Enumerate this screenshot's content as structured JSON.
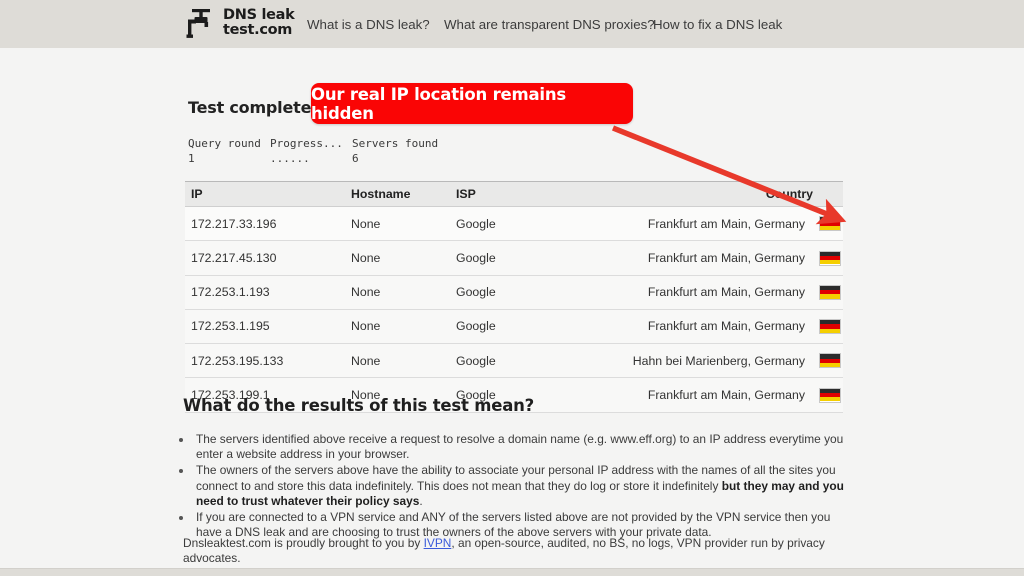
{
  "header": {
    "brand": {
      "line1": "DNS leak",
      "line2": "test.com",
      "icon": "faucet-icon"
    },
    "nav": [
      {
        "label": "What is a DNS leak?"
      },
      {
        "label": "What are transparent DNS proxies?"
      },
      {
        "label": "How to fix a DNS leak"
      }
    ]
  },
  "result": {
    "heading": "Test complete",
    "annotation_badge": "Our real IP location remains hidden",
    "badge_color": "#fa0505",
    "status": [
      {
        "label": "Query round",
        "value": "1"
      },
      {
        "label": "Progress...",
        "value": "......"
      },
      {
        "label": "Servers found",
        "value": "6"
      }
    ]
  },
  "table": {
    "columns": [
      "IP",
      "Hostname",
      "ISP",
      "Country"
    ],
    "rows": [
      {
        "ip": "172.217.33.196",
        "hostname": "None",
        "isp": "Google",
        "country": "Frankfurt am Main, Germany",
        "flag": "de-flag-icon"
      },
      {
        "ip": "172.217.45.130",
        "hostname": "None",
        "isp": "Google",
        "country": "Frankfurt am Main, Germany",
        "flag": "de-flag-icon"
      },
      {
        "ip": "172.253.1.193",
        "hostname": "None",
        "isp": "Google",
        "country": "Frankfurt am Main, Germany",
        "flag": "de-flag-icon"
      },
      {
        "ip": "172.253.1.195",
        "hostname": "None",
        "isp": "Google",
        "country": "Frankfurt am Main, Germany",
        "flag": "de-flag-icon"
      },
      {
        "ip": "172.253.195.133",
        "hostname": "None",
        "isp": "Google",
        "country": "Hahn bei Marienberg, Germany",
        "flag": "de-flag-icon"
      },
      {
        "ip": "172.253.199.1",
        "hostname": "None",
        "isp": "Google",
        "country": "Frankfurt am Main, Germany",
        "flag": "de-flag-icon"
      }
    ]
  },
  "explanation": {
    "title": "What do the results of this test mean?",
    "bullets": [
      {
        "text": "The servers identified above receive a request to resolve a domain name (e.g. www.eff.org) to an IP address everytime you enter a website address in your browser.",
        "bold_tail": ""
      },
      {
        "text": "The owners of the servers above have the ability to associate your personal IP address with the names of all the sites you connect to and store this data indefinitely. This does not mean that they do log or store it indefinitely ",
        "bold_tail": "but they may and you need to trust whatever their policy says",
        "tail": "."
      },
      {
        "text": "If you are connected to a VPN service and ANY of the servers listed above are not provided by the VPN service then you have a DNS leak and are choosing to trust the owners of the above servers with your private data.",
        "bold_tail": ""
      }
    ],
    "footer_pre": "Dnsleaktest.com is proudly brought to you by ",
    "footer_link": "IVPN",
    "footer_post": ", an open-source, audited, no BS, no logs, VPN provider run by privacy advocates."
  }
}
